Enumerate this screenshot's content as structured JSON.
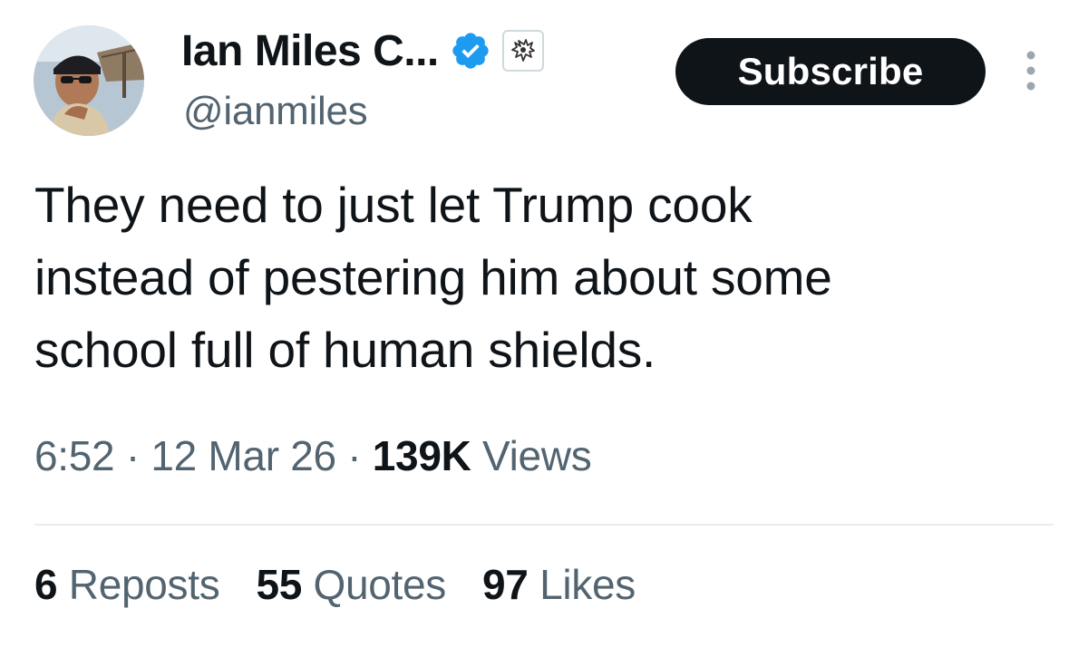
{
  "author": {
    "display_name": "Ian Miles C...",
    "handle": "@ianmiles",
    "verified": true,
    "avatar_icon": "profile-photo",
    "affiliate_badge_icon": "affiliate-badge-icon"
  },
  "actions": {
    "subscribe_label": "Subscribe",
    "more_icon": "more-vertical-icon"
  },
  "tweet": {
    "text": "They need to just let Trump cook\ninstead of pestering him about some\nschool full of human shields."
  },
  "meta": {
    "time": "6:52",
    "separator": "·",
    "date": "12 Mar 26",
    "views_count": "139K",
    "views_label": "Views"
  },
  "stats": {
    "reposts_count": "6",
    "reposts_label": "Reposts",
    "quotes_count": "55",
    "quotes_label": "Quotes",
    "likes_count": "97",
    "likes_label": "Likes"
  },
  "colors": {
    "text_primary": "#0f1419",
    "text_secondary": "#536471",
    "verified_blue": "#1d9bf0",
    "button_bg": "#0f1419",
    "divider": "#e6ecf0"
  }
}
